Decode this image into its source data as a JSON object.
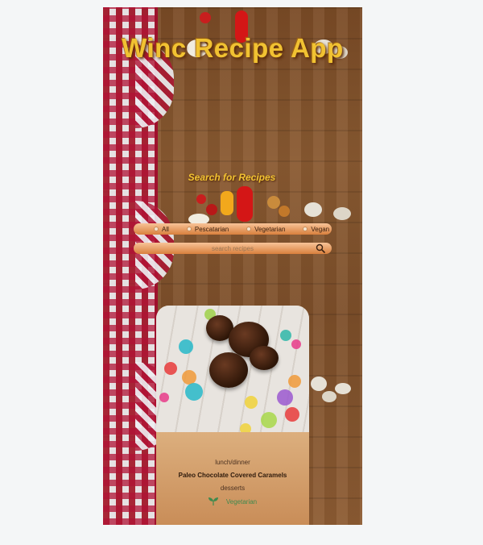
{
  "app": {
    "title": "Winc Recipe App"
  },
  "search_section": {
    "heading": "Search for Recipes",
    "filters": [
      {
        "label": "All"
      },
      {
        "label": "Pescatarian"
      },
      {
        "label": "Vegetarian"
      },
      {
        "label": "Vegan"
      }
    ],
    "search_placeholder": "search recipes",
    "search_icon": "magnifier-icon"
  },
  "recipe_card": {
    "meal_type": "lunch/dinner",
    "title": "Paleo Chocolate Covered Caramels",
    "dish_type": "desserts",
    "diet_label": "Vegetarian",
    "diet_icon": "leaf-sprout-icon"
  },
  "colors": {
    "title": "#f1c232",
    "control_gradient_top": "#f7c397",
    "control_gradient_bottom": "#d9803d",
    "diet_label": "#3f8a4e"
  }
}
